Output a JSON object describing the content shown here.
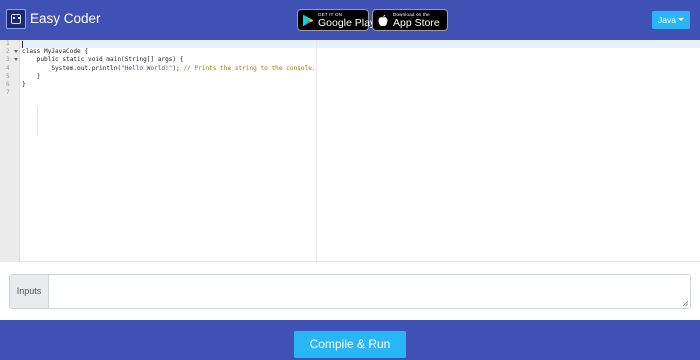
{
  "header": {
    "app_title": "Easy Coder",
    "logo_icon": "robot-face-icon",
    "google_play": {
      "small_text": "GET IT ON",
      "big_text": "Google Play",
      "icon": "google-play-icon"
    },
    "app_store": {
      "small_text": "Download on the",
      "big_text": "App Store",
      "icon": "apple-icon"
    },
    "language": {
      "selected": "Java",
      "icon": "caret-down-icon"
    }
  },
  "editor": {
    "line_numbers": [
      "1",
      "2",
      "3",
      "4",
      "5",
      "6",
      "7"
    ],
    "lines": [
      [],
      [
        {
          "t": "class MyJavaCode {",
          "k": "plain"
        }
      ],
      [
        {
          "t": "    public static void main(String[] args) {",
          "k": "plain"
        }
      ],
      [
        {
          "t": "        System.out.println(",
          "k": "plain"
        },
        {
          "t": "\"Hello World!\"",
          "k": "str"
        },
        {
          "t": "); ",
          "k": "plain"
        },
        {
          "t": "// Prints the string to the console.",
          "k": "com"
        }
      ],
      [
        {
          "t": "    }",
          "k": "plain"
        }
      ],
      [
        {
          "t": "}",
          "k": "plain"
        }
      ],
      []
    ]
  },
  "inputs": {
    "label": "Inputs",
    "value": "",
    "placeholder": ""
  },
  "footer": {
    "run_label": "Compile & Run"
  },
  "colors": {
    "header_bg": "#3f51b5",
    "accent": "#29b6f6"
  }
}
